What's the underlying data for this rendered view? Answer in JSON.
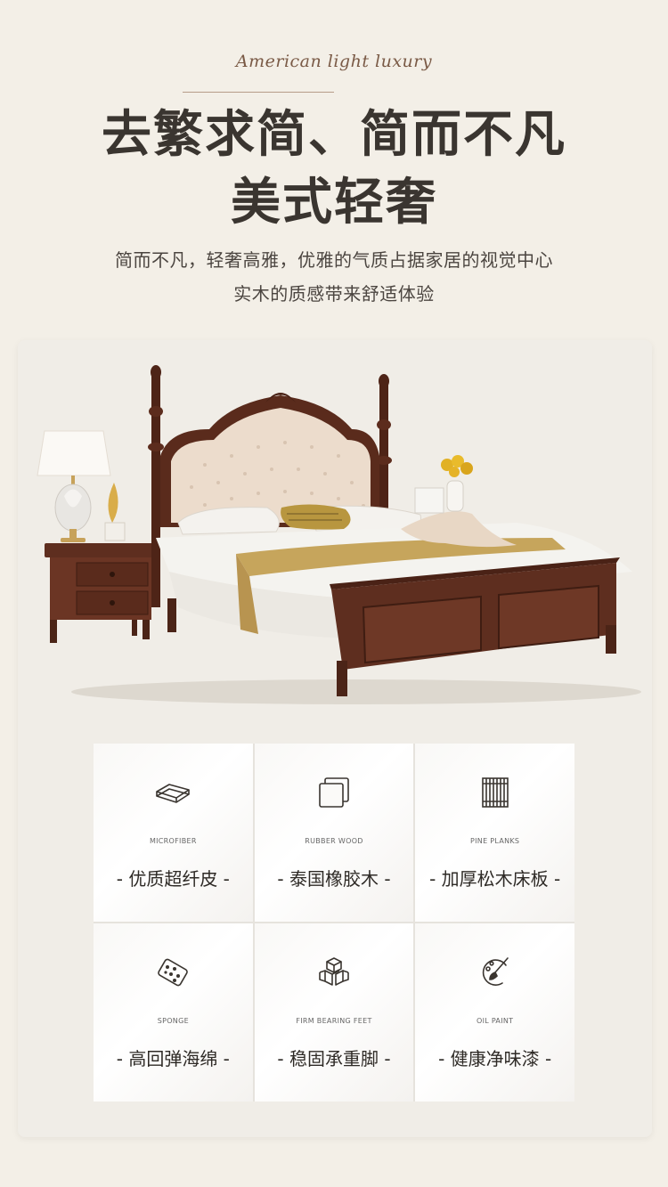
{
  "header": {
    "script_title": "American light luxury",
    "headline_line1": "去繁求简、简而不凡",
    "headline_line2": "美式轻奢",
    "subline_line1": "简而不凡，轻奢高雅，优雅的气质占据家居的视觉中心",
    "subline_line2": "实木的质感带来舒适体验"
  },
  "features": [
    {
      "icon": "layered-fabric-icon",
      "en": "MICROFIBER",
      "zh": "- 优质超纤皮 -"
    },
    {
      "icon": "wood-block-icon",
      "en": "RUBBER WOOD",
      "zh": "- 泰国橡胶木 -"
    },
    {
      "icon": "slat-board-icon",
      "en": "PINE PLANKS",
      "zh": "- 加厚松木床板 -"
    },
    {
      "icon": "sponge-icon",
      "en": "SPONGE",
      "zh": "- 高回弹海绵 -"
    },
    {
      "icon": "stacked-cubes-icon",
      "en": "FIRM BEARING FEET",
      "zh": "- 稳固承重脚 -"
    },
    {
      "icon": "paint-brush-icon",
      "en": "OIL PAINT",
      "zh": "- 健康净味漆 -"
    }
  ],
  "colors": {
    "background": "#f3efe7",
    "card": "#f0ede7",
    "wood": "#5a2d1f",
    "headboard": "#ecdccc",
    "throw": "#c6a55c"
  }
}
